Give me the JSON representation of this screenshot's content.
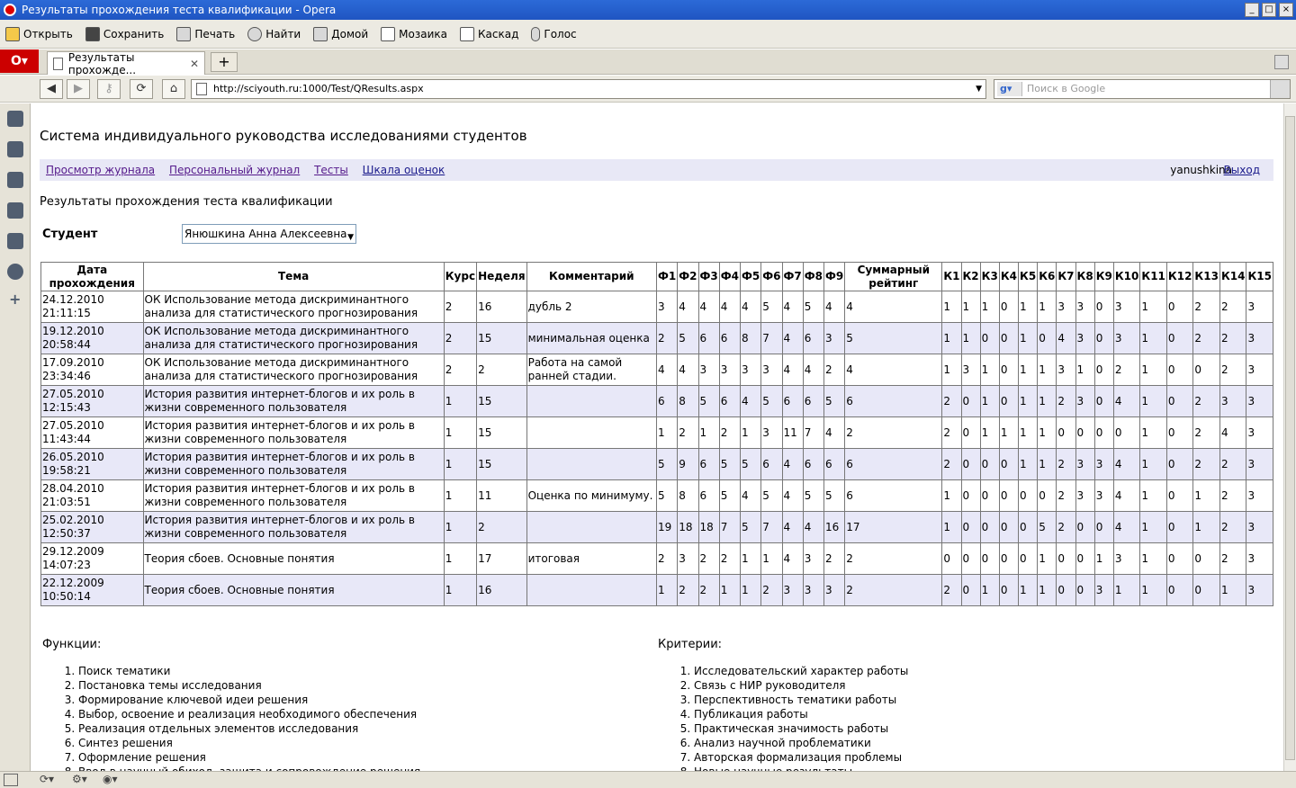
{
  "window": {
    "title": "Результаты прохождения теста квалификации - Opera"
  },
  "toolbar": [
    "Открыть",
    "Сохранить",
    "Печать",
    "Найти",
    "Домой",
    "Мозаика",
    "Каскад",
    "Голос"
  ],
  "tab": {
    "label": "Результаты прохожде..."
  },
  "address": {
    "url": "http://sciyouth.ru:1000/Test/QResults.aspx"
  },
  "search": {
    "placeholder": "Поиск в Google"
  },
  "page": {
    "site_title": "Система индивидуального руководства исследованиями студентов",
    "nav": [
      "Просмотр журнала",
      "Персональный журнал",
      "Тесты",
      "Шкала оценок"
    ],
    "user": "yanushkina",
    "logout": "Выход",
    "heading": "Результаты прохождения теста квалификации",
    "student_label": "Студент",
    "student_value": "Янюшкина Анна Алексеевна"
  },
  "table": {
    "headers": [
      "Дата прохождения",
      "Тема",
      "Курс",
      "Неделя",
      "Комментарий",
      "Ф1",
      "Ф2",
      "Ф3",
      "Ф4",
      "Ф5",
      "Ф6",
      "Ф7",
      "Ф8",
      "Ф9",
      "Суммарный рейтинг",
      "К1",
      "К2",
      "К3",
      "К4",
      "К5",
      "К6",
      "К7",
      "К8",
      "К9",
      "К10",
      "К11",
      "К12",
      "К13",
      "К14",
      "К15"
    ],
    "rows": [
      [
        "24.12.2010 21:11:15",
        "ОК Использование метода дискриминантного анализа для статистического прогнозирования",
        "2",
        "16",
        "дубль 2",
        "3",
        "4",
        "4",
        "4",
        "4",
        "5",
        "4",
        "5",
        "4",
        "4",
        "1",
        "1",
        "1",
        "0",
        "1",
        "1",
        "3",
        "3",
        "0",
        "3",
        "1",
        "0",
        "2",
        "2",
        "3"
      ],
      [
        "19.12.2010 20:58:44",
        "ОК Использование метода дискриминантного анализа для статистического прогнозирования",
        "2",
        "15",
        "минимальная оценка",
        "2",
        "5",
        "6",
        "6",
        "8",
        "7",
        "4",
        "6",
        "3",
        "5",
        "1",
        "1",
        "0",
        "0",
        "1",
        "0",
        "4",
        "3",
        "0",
        "3",
        "1",
        "0",
        "2",
        "2",
        "3"
      ],
      [
        "17.09.2010 23:34:46",
        "ОК Использование метода дискриминантного анализа для статистического прогнозирования",
        "2",
        "2",
        "Работа на самой ранней стадии.",
        "4",
        "4",
        "3",
        "3",
        "3",
        "3",
        "4",
        "4",
        "2",
        "4",
        "1",
        "3",
        "1",
        "0",
        "1",
        "1",
        "3",
        "1",
        "0",
        "2",
        "1",
        "0",
        "0",
        "2",
        "3"
      ],
      [
        "27.05.2010 12:15:43",
        "История развития интернет-блогов и их роль в жизни современного пользователя",
        "1",
        "15",
        "",
        "6",
        "8",
        "5",
        "6",
        "4",
        "5",
        "6",
        "6",
        "5",
        "6",
        "2",
        "0",
        "1",
        "0",
        "1",
        "1",
        "2",
        "3",
        "0",
        "4",
        "1",
        "0",
        "2",
        "3",
        "3"
      ],
      [
        "27.05.2010 11:43:44",
        "История развития интернет-блогов и их роль в жизни современного пользователя",
        "1",
        "15",
        "",
        "1",
        "2",
        "1",
        "2",
        "1",
        "3",
        "11",
        "7",
        "4",
        "2",
        "2",
        "0",
        "1",
        "1",
        "1",
        "1",
        "0",
        "0",
        "0",
        "0",
        "1",
        "0",
        "2",
        "4",
        "3"
      ],
      [
        "26.05.2010 19:58:21",
        "История развития интернет-блогов и их роль в жизни современного пользователя",
        "1",
        "15",
        "",
        "5",
        "9",
        "6",
        "5",
        "5",
        "6",
        "4",
        "6",
        "6",
        "6",
        "2",
        "0",
        "0",
        "0",
        "1",
        "1",
        "2",
        "3",
        "3",
        "4",
        "1",
        "0",
        "2",
        "2",
        "3"
      ],
      [
        "28.04.2010 21:03:51",
        "История развития интернет-блогов и их роль в жизни современного пользователя",
        "1",
        "11",
        "Оценка по минимуму.",
        "5",
        "8",
        "6",
        "5",
        "4",
        "5",
        "4",
        "5",
        "5",
        "6",
        "1",
        "0",
        "0",
        "0",
        "0",
        "0",
        "2",
        "3",
        "3",
        "4",
        "1",
        "0",
        "1",
        "2",
        "3"
      ],
      [
        "25.02.2010 12:50:37",
        "История развития интернет-блогов и их роль в жизни современного пользователя",
        "1",
        "2",
        "",
        "19",
        "18",
        "18",
        "7",
        "5",
        "7",
        "4",
        "4",
        "16",
        "17",
        "1",
        "0",
        "0",
        "0",
        "0",
        "5",
        "2",
        "0",
        "0",
        "4",
        "1",
        "0",
        "1",
        "2",
        "3"
      ],
      [
        "29.12.2009 14:07:23",
        "Теория сбоев. Основные понятия",
        "1",
        "17",
        "итоговая",
        "2",
        "3",
        "2",
        "2",
        "1",
        "1",
        "4",
        "3",
        "2",
        "2",
        "0",
        "0",
        "0",
        "0",
        "0",
        "1",
        "0",
        "0",
        "1",
        "3",
        "1",
        "0",
        "0",
        "2",
        "3"
      ],
      [
        "22.12.2009 10:50:14",
        "Теория сбоев. Основные понятия",
        "1",
        "16",
        "",
        "1",
        "2",
        "2",
        "1",
        "1",
        "2",
        "3",
        "3",
        "3",
        "2",
        "2",
        "0",
        "1",
        "0",
        "1",
        "1",
        "0",
        "0",
        "3",
        "1",
        "1",
        "0",
        "0",
        "1",
        "3"
      ]
    ]
  },
  "functions": {
    "title": "Функции:",
    "items": [
      "Поиск тематики",
      "Постановка темы исследования",
      "Формирование ключевой идеи решения",
      "Выбор, освоение и реализация необходимого обеспечения",
      "Реализация отдельных элементов исследования",
      "Синтез решения",
      "Оформление решения",
      "Ввод в научный обиход, защита и сопровождение решения"
    ]
  },
  "criteria": {
    "title": "Критерии:",
    "items": [
      "Исследовательский характер работы",
      "Связь с НИР руководителя",
      "Перспективность тематики работы",
      "Публикация работы",
      "Практическая значимость работы",
      "Анализ научной проблематики",
      "Авторская формализация проблемы",
      "Новые научные результаты"
    ]
  }
}
